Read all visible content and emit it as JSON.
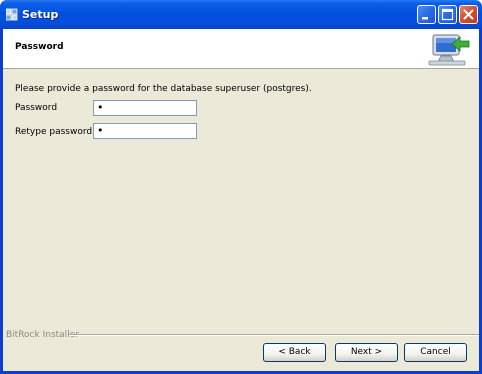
{
  "window": {
    "title": "Setup"
  },
  "header": {
    "title": "Password"
  },
  "content": {
    "description": "Please provide a password for the database superuser (postgres).",
    "password_label": "Password",
    "password_value": "•",
    "retype_label": "Retype password",
    "retype_value": "•"
  },
  "footer": {
    "brand": "BitRock Installer",
    "back_label": "< Back",
    "next_label": "Next >",
    "cancel_label": "Cancel"
  },
  "icons": {
    "app": "installer-app-icon",
    "minimize": "minimize-icon",
    "maximize": "maximize-icon",
    "close": "close-icon",
    "header_graphic": "computer-install-icon"
  },
  "colors": {
    "titlebar": "#0350e0",
    "client_bg": "#ece9d8",
    "close_button": "#d4502f"
  }
}
